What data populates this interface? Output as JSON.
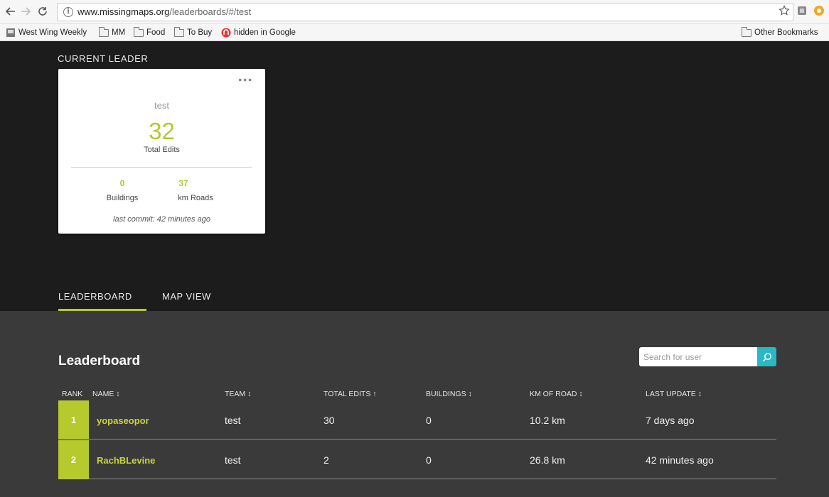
{
  "browser": {
    "url_host": "www.missingmaps.org",
    "url_path": "/leaderboards/#/test",
    "bookmarks": [
      "West Wing Weekly",
      "MM",
      "Food",
      "To Buy",
      "hidden in Google"
    ],
    "other_bookmarks": "Other Bookmarks"
  },
  "hero": {
    "current_leader_label": "CURRENT LEADER",
    "card": {
      "username": "test",
      "total_edits": "32",
      "total_edits_label": "Total Edits",
      "buildings_value": "0",
      "buildings_label": "Buildings",
      "roads_value": "37",
      "roads_label": "km Roads",
      "last_commit": "last commit: 42 minutes ago"
    },
    "tabs": [
      "LEADERBOARD",
      "MAP VIEW"
    ],
    "active_tab": "LEADERBOARD"
  },
  "leaderboard": {
    "title": "Leaderboard",
    "search_placeholder": "Search for user",
    "columns": [
      "RANK",
      "NAME ↕",
      "TEAM ↕",
      "TOTAL EDITS ↑",
      "BUILDINGS ↕",
      "KM OF ROAD ↕",
      "LAST UPDATE ↕"
    ],
    "rows": [
      {
        "rank": "1",
        "name": "yopaseopor",
        "team": "test",
        "total_edits": "30",
        "buildings": "0",
        "km_road": "10.2 km",
        "last_update": "7 days ago"
      },
      {
        "rank": "2",
        "name": "RachBLevine",
        "team": "test",
        "total_edits": "2",
        "buildings": "0",
        "km_road": "26.8 km",
        "last_update": "42 minutes ago"
      }
    ]
  },
  "colors": {
    "accent_green": "#b6c92d",
    "search_teal": "#2ab8c4",
    "hero_bg": "#1c1c1c",
    "board_bg": "#3a3a3a"
  }
}
